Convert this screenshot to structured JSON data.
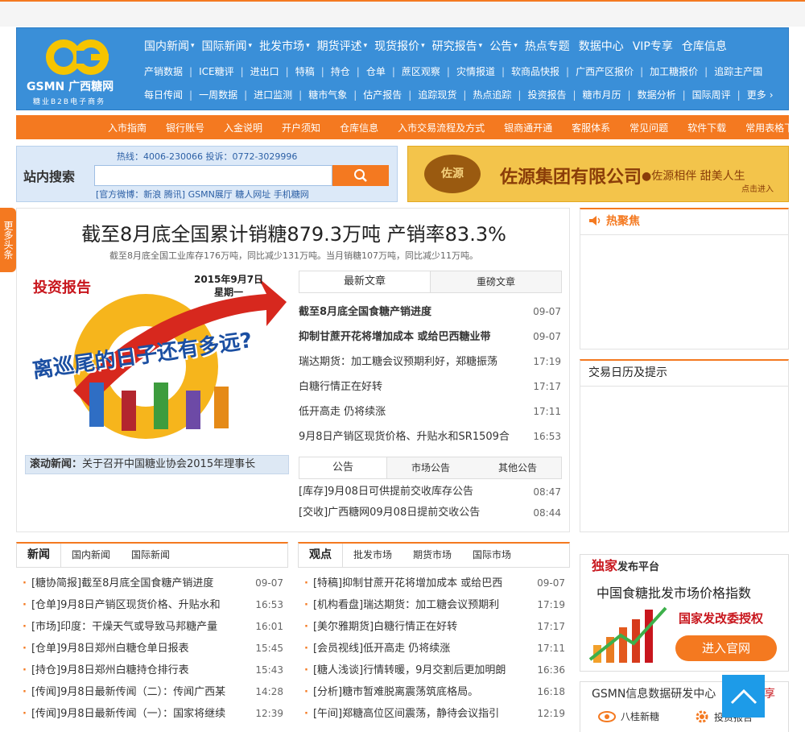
{
  "colors": {
    "brand_blue": "#3a8fd8",
    "accent_orange": "#f47920",
    "headline_red": "#c8161d"
  },
  "logo": {
    "brand": "GSMN 广西糖网",
    "tagline": "糖业B2B电子商务"
  },
  "nav": {
    "row1": [
      "国内新闻",
      "国际新闻",
      "批发市场",
      "期货评述",
      "现货报价",
      "研究报告",
      "公告",
      "热点专题",
      "数据中心",
      "VIP专享",
      "仓库信息"
    ],
    "row1_dropdown": [
      true,
      true,
      true,
      true,
      true,
      true,
      true,
      false,
      false,
      false,
      false
    ],
    "row2": [
      "产销数据",
      "ICE糖评",
      "进出口",
      "特稿",
      "持仓",
      "仓单",
      "蔗区观察",
      "灾情报道",
      "软商品快报",
      "广西产区报价",
      "加工糖报价",
      "追踪主产国"
    ],
    "row3": [
      "每日传闻",
      "一周数据",
      "进口监测",
      "糖市气象",
      "估产报告",
      "追踪现货",
      "热点追踪",
      "投资报告",
      "糖市月历",
      "数据分析",
      "国际周评",
      "更多"
    ]
  },
  "orangebar": [
    "入市指南",
    "银行账号",
    "入金说明",
    "开户须知",
    "仓库信息",
    "入市交易流程及方式",
    "银商通开通",
    "客服体系",
    "常见问题",
    "软件下载",
    "常用表格下载"
  ],
  "search": {
    "label": "站内搜索",
    "hotline": "热线：4006-230066   投诉：0772-3029996",
    "placeholder": "",
    "links": "[官方微博：新浪 腾讯] GSMN展厅 糖人网址 手机糖网"
  },
  "ad": {
    "logo_text": "佐源",
    "company": "佐源集团有限公司",
    "slogan": "●佐源相伴 甜美人生",
    "enter": "点击进入"
  },
  "sidetab": "更多头条",
  "headline": {
    "title": "截至8月底全国累计销糖879.3万吨 产销率83.3%",
    "summary": "截至8月底全国工业库存176万吨，同比减少131万吨。当月销糖107万吨，同比减少11万吨。"
  },
  "hero": {
    "tag": "投资报告",
    "date": "2015年9月7日",
    "weekday": "星期一",
    "caption": "离巡尾的日子还有多远?"
  },
  "scroll_news": {
    "label": "滚动新闻：",
    "text": "关于召开中国糖业协会2015年理事长"
  },
  "tabs_latest": [
    "最新文章",
    "重磅文章"
  ],
  "latest": [
    {
      "title": "截至8月底全国食糖产销进度",
      "time": "09-07",
      "bold": true
    },
    {
      "title": "抑制甘蔗开花将增加成本 或给巴西糖业带",
      "time": "09-07",
      "bold": true
    },
    {
      "title": "瑞达期货：加工糖会议预期利好，郑糖振荡",
      "time": "17:19",
      "bold": false
    },
    {
      "title": "白糖行情正在好转",
      "time": "17:17",
      "bold": false
    },
    {
      "title": "低开高走 仍将续涨",
      "time": "17:11",
      "bold": false
    },
    {
      "title": "9月8日产销区现货价格、升贴水和SR1509合",
      "time": "16:53",
      "bold": false
    }
  ],
  "tabs_notice": [
    "公告",
    "市场公告",
    "其他公告"
  ],
  "notices": [
    {
      "title": "[库存]9月08日可供提前交收库存公告",
      "time": "08:47"
    },
    {
      "title": "[交收]广西糖网09月08日提前交收公告",
      "time": "08:44"
    }
  ],
  "hot": {
    "title": "热聚焦"
  },
  "calendar": {
    "title": "交易日历及提示"
  },
  "news_tabs": [
    "新闻",
    "国内新闻",
    "国际新闻"
  ],
  "news": [
    {
      "title": "[糖协简报]截至8月底全国食糖产销进度",
      "time": "09-07"
    },
    {
      "title": "[仓单]9月8日产销区现货价格、升贴水和",
      "time": "16:53"
    },
    {
      "title": "[市场]印度：干燥天气或导致马邦糖产量",
      "time": "16:01"
    },
    {
      "title": "[仓单]9月8日郑州白糖仓单日报表",
      "time": "15:45"
    },
    {
      "title": "[持仓]9月8日郑州白糖持仓排行表",
      "time": "15:43"
    },
    {
      "title": "[传闻]9月8日最新传闻（二）：传闻广西某",
      "time": "14:28"
    },
    {
      "title": "[传闻]9月8日最新传闻（一）：国家将继续",
      "time": "12:39"
    }
  ],
  "view_tabs": [
    "观点",
    "批发市场",
    "期货市场",
    "国际市场"
  ],
  "views": [
    {
      "title": "[特稿]抑制甘蔗开花将增加成本 或给巴西",
      "time": "09-07"
    },
    {
      "title": "[机构看盘]瑞达期货：加工糖会议预期利",
      "time": "17:19"
    },
    {
      "title": "[美尔雅期货]白糖行情正在好转",
      "time": "17:17"
    },
    {
      "title": "[会员视线]低开高走 仍将续涨",
      "time": "17:11"
    },
    {
      "title": "[糖人浅谈]行情转暖，9月交割后更加明朗",
      "time": "16:36"
    },
    {
      "title": "[分析]糖市暂难脱离震荡筑底格局。",
      "time": "16:18"
    },
    {
      "title": "[午间]郑糖高位区间震荡，静待会议指引",
      "time": "12:19"
    }
  ],
  "dujia": {
    "tag": "独家",
    "tag_rest": "发布平台",
    "title": "中国食糖批发市场价格指数",
    "auth": "国家发改委授权",
    "button": "进入官网"
  },
  "gsmn": {
    "title": "GSMN信息数据研发中心",
    "share": "享",
    "item1": "八桂新糖",
    "item2": "投资报告"
  }
}
